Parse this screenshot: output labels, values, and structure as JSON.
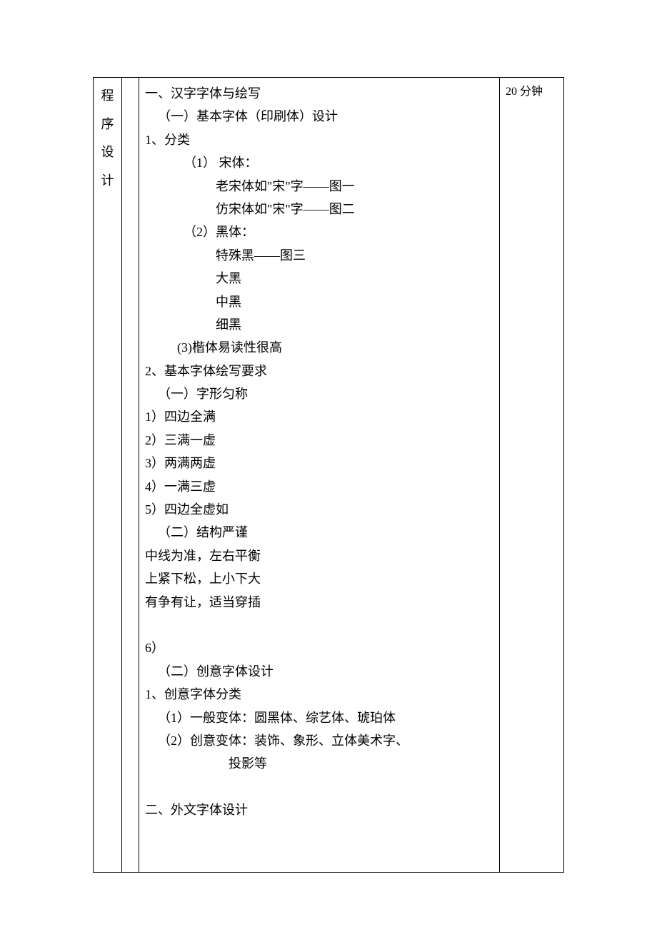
{
  "left_column": [
    "程",
    "序",
    "设",
    "计"
  ],
  "right_column": "20 分钟",
  "lines": [
    {
      "cls": "ind0",
      "text": "一、汉字字体与绘写"
    },
    {
      "cls": "ind1",
      "text": "（一）基本字体（印刷体）设计"
    },
    {
      "cls": "ind0",
      "text": "1、分类"
    },
    {
      "cls": "ind3",
      "text": "（1） 宋体："
    },
    {
      "cls": "ind5",
      "text": "老宋体如\"宋\"字——图一"
    },
    {
      "cls": "ind5",
      "text": "仿宋体如\"宋\"字——图二"
    },
    {
      "cls": "ind3",
      "text": "（2）黑体："
    },
    {
      "cls": "ind5",
      "text": "特殊黑——图三"
    },
    {
      "cls": "ind5",
      "text": "大黑"
    },
    {
      "cls": "ind5",
      "text": "中黑"
    },
    {
      "cls": "ind5",
      "text": "细黑"
    },
    {
      "cls": "ind2h",
      "text": "(3)楷体易读性很高"
    },
    {
      "cls": "ind0",
      "text": "2、基本字体绘写要求"
    },
    {
      "cls": "ind1",
      "text": "（一）字形匀称"
    },
    {
      "cls": "ind0",
      "text": "1）四边全满"
    },
    {
      "cls": "ind0",
      "text": "2）三满一虚"
    },
    {
      "cls": "ind0",
      "text": "3）两满两虚"
    },
    {
      "cls": "ind0",
      "text": "4）一满三虚"
    },
    {
      "cls": "ind0",
      "text": "5）四边全虚如"
    },
    {
      "cls": "ind1",
      "text": "（二）结构严谨"
    },
    {
      "cls": "ind0",
      "text": "中线为准，左右平衡"
    },
    {
      "cls": "ind0",
      "text": "上紧下松，上小下大"
    },
    {
      "cls": "ind0",
      "text": "有争有让，适当穿插"
    },
    {
      "cls": "ind0",
      "text": " "
    },
    {
      "cls": "ind0",
      "text": "6）"
    },
    {
      "cls": "ind1",
      "text": "（二）创意字体设计"
    },
    {
      "cls": "ind0",
      "text": "1、创意字体分类"
    },
    {
      "cls": "ind1",
      "text": "（1）一般变体：圆黑体、综艺体、琥珀体"
    },
    {
      "cls": "ind1",
      "text": "（2）创意变体：装饰、象形、立体美术字、"
    },
    {
      "cls": "ind7",
      "text": "投影等"
    },
    {
      "cls": "ind0",
      "text": " "
    },
    {
      "cls": "ind0",
      "text": "二、外文字体设计"
    },
    {
      "cls": "ind0",
      "text": " "
    },
    {
      "cls": "ind0",
      "text": " "
    }
  ]
}
